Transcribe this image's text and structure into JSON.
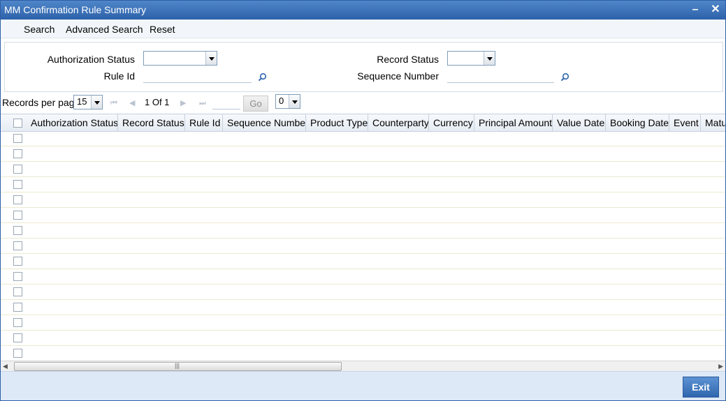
{
  "window": {
    "title": "MM Confirmation Rule Summary",
    "minimize_label": "–",
    "close_label": "✕"
  },
  "toolbar": {
    "search": "Search",
    "advanced_search": "Advanced Search",
    "reset": "Reset"
  },
  "criteria": {
    "authorization_status_label": "Authorization Status",
    "authorization_status_value": "",
    "record_status_label": "Record Status",
    "record_status_value": "",
    "rule_id_label": "Rule Id",
    "rule_id_value": "",
    "sequence_number_label": "Sequence Number",
    "sequence_number_value": ""
  },
  "pager": {
    "records_per_page_label": "Records per page",
    "records_per_page_value": "15",
    "page_text": "1 Of 1",
    "goto_value": "",
    "go_label": "Go",
    "option_value": "0"
  },
  "grid": {
    "columns": [
      "Authorization Status",
      "Record Status",
      "Rule Id",
      "Sequence Number",
      "Product Type",
      "Counterparty",
      "Currency",
      "Principal Amount",
      "Value Date",
      "Booking Date",
      "Event",
      "Maturity"
    ],
    "row_count": 15
  },
  "footer": {
    "exit_label": "Exit"
  },
  "colors": {
    "titlebar": "#3a72bb",
    "footer": "#dde9f7",
    "exit_button": "#3f76bd"
  }
}
